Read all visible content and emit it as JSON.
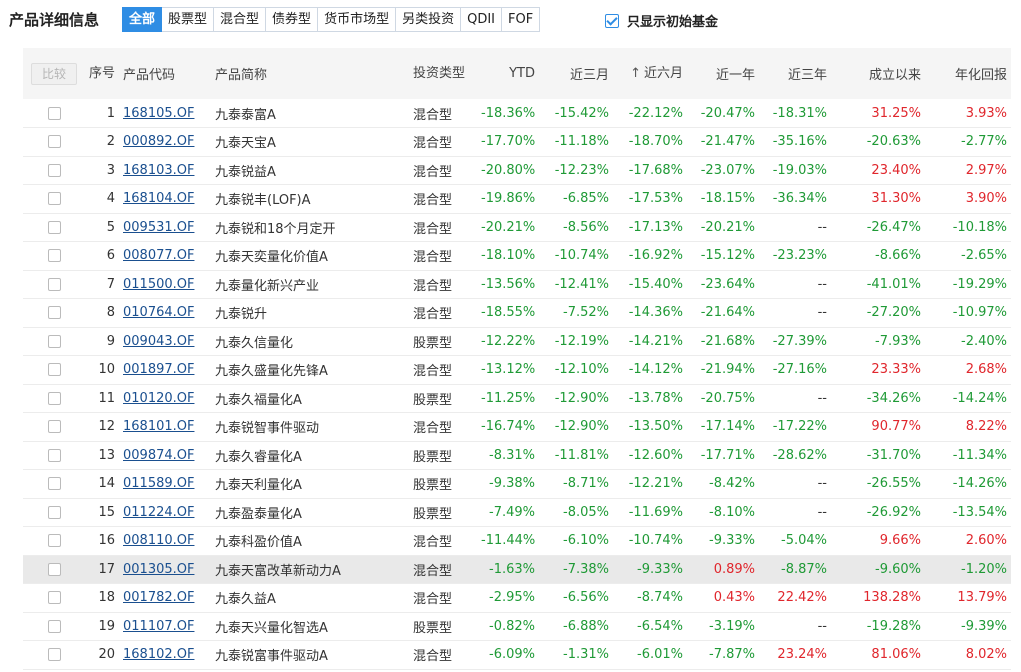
{
  "header": {
    "title": "产品详细信息",
    "tabs": [
      {
        "label": "全部",
        "active": true
      },
      {
        "label": "股票型",
        "active": false
      },
      {
        "label": "混合型",
        "active": false
      },
      {
        "label": "债券型",
        "active": false
      },
      {
        "label": "货币市场型",
        "active": false
      },
      {
        "label": "另类投资",
        "active": false
      },
      {
        "label": "QDII",
        "active": false
      },
      {
        "label": "FOF",
        "active": false
      }
    ],
    "filter_label": "只显示初始基金",
    "filter_checked": true
  },
  "table": {
    "compare_button": "比较",
    "columns": {
      "index": "序号",
      "code": "产品代码",
      "name": "产品简称",
      "type": "投资类型",
      "ytd": "YTD",
      "m3": "近三月",
      "m6": "近六月",
      "y1": "近一年",
      "y3": "近三年",
      "since": "成立以来",
      "annual": "年化回报"
    },
    "sorted_column": "m6",
    "sort_direction": "up",
    "rows": [
      {
        "index": "1",
        "code": "168105.OF",
        "name": "九泰泰富A",
        "type": "混合型",
        "ytd": "-18.36%",
        "m3": "-15.42%",
        "m6": "-22.12%",
        "y1": "-20.47%",
        "y3": "-18.31%",
        "since": "31.25%",
        "annual": "3.93%"
      },
      {
        "index": "2",
        "code": "000892.OF",
        "name": "九泰天宝A",
        "type": "混合型",
        "ytd": "-17.70%",
        "m3": "-11.18%",
        "m6": "-18.70%",
        "y1": "-21.47%",
        "y3": "-35.16%",
        "since": "-20.63%",
        "annual": "-2.77%"
      },
      {
        "index": "3",
        "code": "168103.OF",
        "name": "九泰锐益A",
        "type": "混合型",
        "ytd": "-20.80%",
        "m3": "-12.23%",
        "m6": "-17.68%",
        "y1": "-23.07%",
        "y3": "-19.03%",
        "since": "23.40%",
        "annual": "2.97%"
      },
      {
        "index": "4",
        "code": "168104.OF",
        "name": "九泰锐丰(LOF)A",
        "type": "混合型",
        "ytd": "-19.86%",
        "m3": "-6.85%",
        "m6": "-17.53%",
        "y1": "-18.15%",
        "y3": "-36.34%",
        "since": "31.30%",
        "annual": "3.90%"
      },
      {
        "index": "5",
        "code": "009531.OF",
        "name": "九泰锐和18个月定开",
        "type": "混合型",
        "ytd": "-20.21%",
        "m3": "-8.56%",
        "m6": "-17.13%",
        "y1": "-20.21%",
        "y3": "--",
        "since": "-26.47%",
        "annual": "-10.18%"
      },
      {
        "index": "6",
        "code": "008077.OF",
        "name": "九泰天奕量化价值A",
        "type": "混合型",
        "ytd": "-18.10%",
        "m3": "-10.74%",
        "m6": "-16.92%",
        "y1": "-15.12%",
        "y3": "-23.23%",
        "since": "-8.66%",
        "annual": "-2.65%"
      },
      {
        "index": "7",
        "code": "011500.OF",
        "name": "九泰量化新兴产业",
        "type": "混合型",
        "ytd": "-13.56%",
        "m3": "-12.41%",
        "m6": "-15.40%",
        "y1": "-23.64%",
        "y3": "--",
        "since": "-41.01%",
        "annual": "-19.29%"
      },
      {
        "index": "8",
        "code": "010764.OF",
        "name": "九泰锐升",
        "type": "混合型",
        "ytd": "-18.55%",
        "m3": "-7.52%",
        "m6": "-14.36%",
        "y1": "-21.64%",
        "y3": "--",
        "since": "-27.20%",
        "annual": "-10.97%"
      },
      {
        "index": "9",
        "code": "009043.OF",
        "name": "九泰久信量化",
        "type": "股票型",
        "ytd": "-12.22%",
        "m3": "-12.19%",
        "m6": "-14.21%",
        "y1": "-21.68%",
        "y3": "-27.39%",
        "since": "-7.93%",
        "annual": "-2.40%"
      },
      {
        "index": "10",
        "code": "001897.OF",
        "name": "九泰久盛量化先锋A",
        "type": "混合型",
        "ytd": "-13.12%",
        "m3": "-12.10%",
        "m6": "-14.12%",
        "y1": "-21.94%",
        "y3": "-27.16%",
        "since": "23.33%",
        "annual": "2.68%"
      },
      {
        "index": "11",
        "code": "010120.OF",
        "name": "九泰久福量化A",
        "type": "股票型",
        "ytd": "-11.25%",
        "m3": "-12.90%",
        "m6": "-13.78%",
        "y1": "-20.75%",
        "y3": "--",
        "since": "-34.26%",
        "annual": "-14.24%"
      },
      {
        "index": "12",
        "code": "168101.OF",
        "name": "九泰锐智事件驱动",
        "type": "混合型",
        "ytd": "-16.74%",
        "m3": "-12.90%",
        "m6": "-13.50%",
        "y1": "-17.14%",
        "y3": "-17.22%",
        "since": "90.77%",
        "annual": "8.22%"
      },
      {
        "index": "13",
        "code": "009874.OF",
        "name": "九泰久睿量化A",
        "type": "股票型",
        "ytd": "-8.31%",
        "m3": "-11.81%",
        "m6": "-12.60%",
        "y1": "-17.71%",
        "y3": "-28.62%",
        "since": "-31.70%",
        "annual": "-11.34%"
      },
      {
        "index": "14",
        "code": "011589.OF",
        "name": "九泰天利量化A",
        "type": "股票型",
        "ytd": "-9.38%",
        "m3": "-8.71%",
        "m6": "-12.21%",
        "y1": "-8.42%",
        "y3": "--",
        "since": "-26.55%",
        "annual": "-14.26%"
      },
      {
        "index": "15",
        "code": "011224.OF",
        "name": "九泰盈泰量化A",
        "type": "股票型",
        "ytd": "-7.49%",
        "m3": "-8.05%",
        "m6": "-11.69%",
        "y1": "-8.10%",
        "y3": "--",
        "since": "-26.92%",
        "annual": "-13.54%"
      },
      {
        "index": "16",
        "code": "008110.OF",
        "name": "九泰科盈价值A",
        "type": "混合型",
        "ytd": "-11.44%",
        "m3": "-6.10%",
        "m6": "-10.74%",
        "y1": "-9.33%",
        "y3": "-5.04%",
        "since": "9.66%",
        "annual": "2.60%"
      },
      {
        "index": "17",
        "code": "001305.OF",
        "name": "九泰天富改革新动力A",
        "type": "混合型",
        "ytd": "-1.63%",
        "m3": "-7.38%",
        "m6": "-9.33%",
        "y1": "0.89%",
        "y3": "-8.87%",
        "since": "-9.60%",
        "annual": "-1.20%",
        "highlight": true
      },
      {
        "index": "18",
        "code": "001782.OF",
        "name": "九泰久益A",
        "type": "混合型",
        "ytd": "-2.95%",
        "m3": "-6.56%",
        "m6": "-8.74%",
        "y1": "0.43%",
        "y3": "22.42%",
        "since": "138.28%",
        "annual": "13.79%"
      },
      {
        "index": "19",
        "code": "011107.OF",
        "name": "九泰天兴量化智选A",
        "type": "股票型",
        "ytd": "-0.82%",
        "m3": "-6.88%",
        "m6": "-6.54%",
        "y1": "-3.19%",
        "y3": "--",
        "since": "-19.28%",
        "annual": "-9.39%"
      },
      {
        "index": "20",
        "code": "168102.OF",
        "name": "九泰锐富事件驱动A",
        "type": "混合型",
        "ytd": "-6.09%",
        "m3": "-1.31%",
        "m6": "-6.01%",
        "y1": "-7.87%",
        "y3": "23.24%",
        "since": "81.06%",
        "annual": "8.02%"
      }
    ]
  },
  "colors": {
    "accent": "#2f8de4",
    "positive": "#e0262c",
    "negative": "#1f9a36",
    "link": "#1a4f8f"
  }
}
